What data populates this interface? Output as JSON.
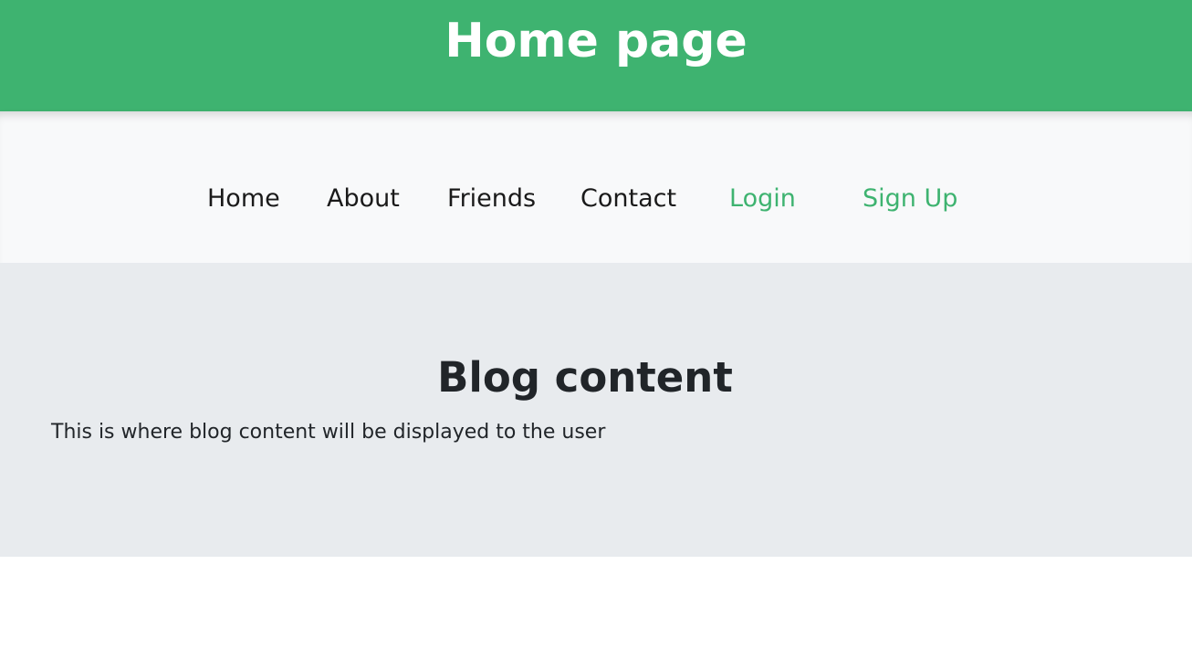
{
  "header": {
    "title": "Home page"
  },
  "nav": {
    "items": [
      {
        "label": "Home"
      },
      {
        "label": "About"
      },
      {
        "label": "Friends"
      },
      {
        "label": "Contact"
      },
      {
        "label": "Login"
      },
      {
        "label": "Sign Up"
      }
    ]
  },
  "main": {
    "heading": "Blog content",
    "body": "This is where blog content will be displayed to the user"
  },
  "colors": {
    "accent": "#3eb370",
    "nav_background": "#f8f9fa",
    "content_background": "#e8ebee",
    "text": "#212529"
  }
}
